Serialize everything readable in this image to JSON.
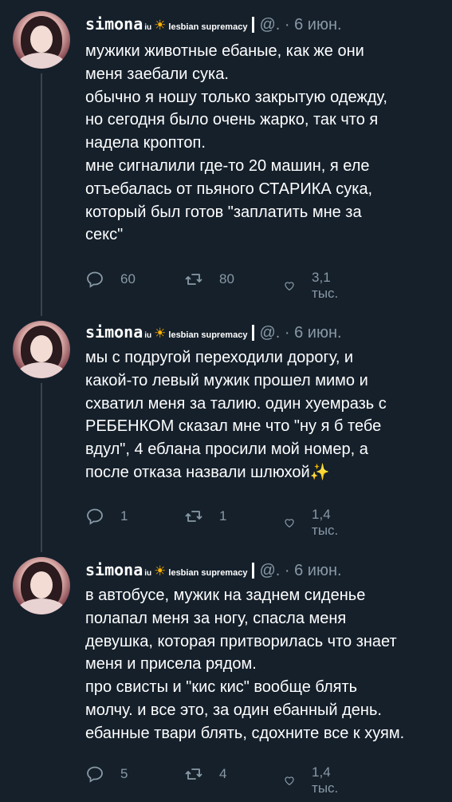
{
  "tweets": [
    {
      "name": "simona",
      "name_sup": "iu",
      "sun_glyph": "☀",
      "flair": "lesbian supremacy",
      "handle": "@. · 6 июн.",
      "text": "мужики животные ебаные, как же они\nменя заебали сука.\nобычно я ношу только закрытую одежду,\nно сегодня было очень жарко, так что я\nнадела кроптоп.\nмне сигналили где-то 20 машин, я еле\nотъебалась от пьяного СТАРИКА сука,\nкоторый был готов \"заплатить мне за\nсекс\"",
      "replies": "60",
      "retweets": "80",
      "likes": "3,1 тыс."
    },
    {
      "name": "simona",
      "name_sup": "iu",
      "sun_glyph": "☀",
      "flair": "lesbian supremacy",
      "handle": "@. · 6 июн.",
      "text": "мы с подругой переходили дорогу, и\nкакой-то левый мужик прошел мимо и\nсхватил меня за талию. один хуемразь с\nРЕБЕНКОМ сказал мне что \"ну я б тебе\nвдул\", 4 еблана просили мой номер, а\nпосле отказа назвали шлюхой✨",
      "replies": "1",
      "retweets": "1",
      "likes": "1,4 тыс."
    },
    {
      "name": "simona",
      "name_sup": "iu",
      "sun_glyph": "☀",
      "flair": "lesbian supremacy",
      "handle": "@. · 6 июн.",
      "text": "в автобусе, мужик на заднем сиденье\nполапал меня за ногу, спасла меня\nдевушка, которая притворилась что знает\nменя и присела рядом.\nпро свисты и \"кис кис\" вообще блять\nмолчу. и все это, за один ебанный день.\nебанные твари блять, сдохните все к хуям.",
      "replies": "5",
      "retweets": "4",
      "likes": "1,4 тыс."
    }
  ],
  "colors": {
    "background": "#15202b",
    "text": "#ffffff",
    "secondary": "#8899a6",
    "thread_line": "#38444d",
    "sun": "#ffb000"
  },
  "icons": [
    "reply-icon",
    "retweet-icon",
    "like-icon",
    "sun-icon"
  ]
}
